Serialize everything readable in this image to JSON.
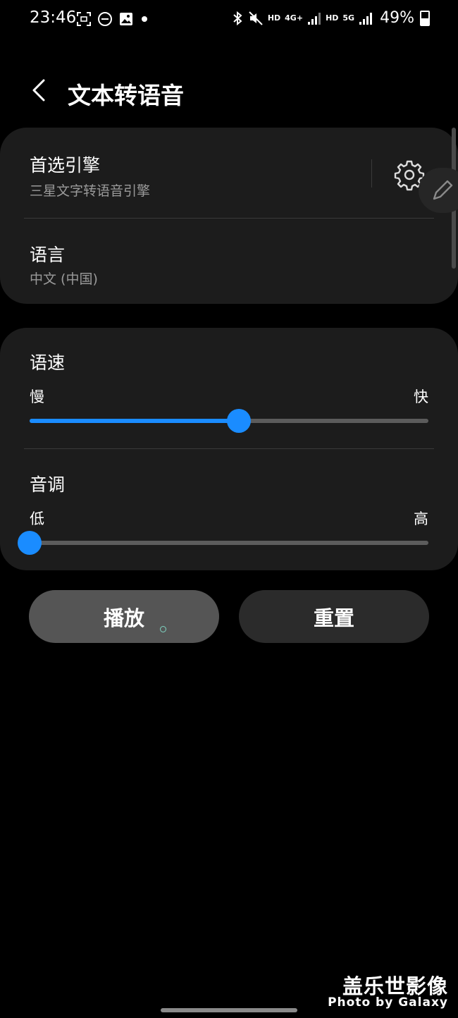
{
  "status_bar": {
    "time": "23:46",
    "battery": "49%",
    "net_hd1": "HD",
    "net_4g": "4G+",
    "net_hd2": "HD",
    "net_5g": "5G",
    "left_icons": [
      "screenshot-icon",
      "dnd-icon",
      "gallery-icon",
      "dot-icon"
    ],
    "right_icons": [
      "bluetooth-icon",
      "mute-icon",
      "signal-icon",
      "signal-icon",
      "battery-icon"
    ]
  },
  "header": {
    "title": "文本转语音"
  },
  "engine_card": {
    "preferred_engine_label": "首选引擎",
    "preferred_engine_value": "三星文字转语音引擎",
    "language_label": "语言",
    "language_value": "中文 (中国)"
  },
  "speech_card": {
    "rate_label": "语速",
    "rate_min_label": "慢",
    "rate_max_label": "快",
    "rate_value": 0.525,
    "pitch_label": "音调",
    "pitch_min_label": "低",
    "pitch_max_label": "高",
    "pitch_value": 0.0
  },
  "buttons": {
    "play_label": "播放",
    "reset_label": "重置"
  },
  "watermark": {
    "main": "盖乐世影像",
    "sub": "Photo by Galaxy"
  },
  "colors": {
    "accent": "#1a8cff",
    "card_bg": "#1c1c1c",
    "secondary_text": "#9a9a9a"
  }
}
